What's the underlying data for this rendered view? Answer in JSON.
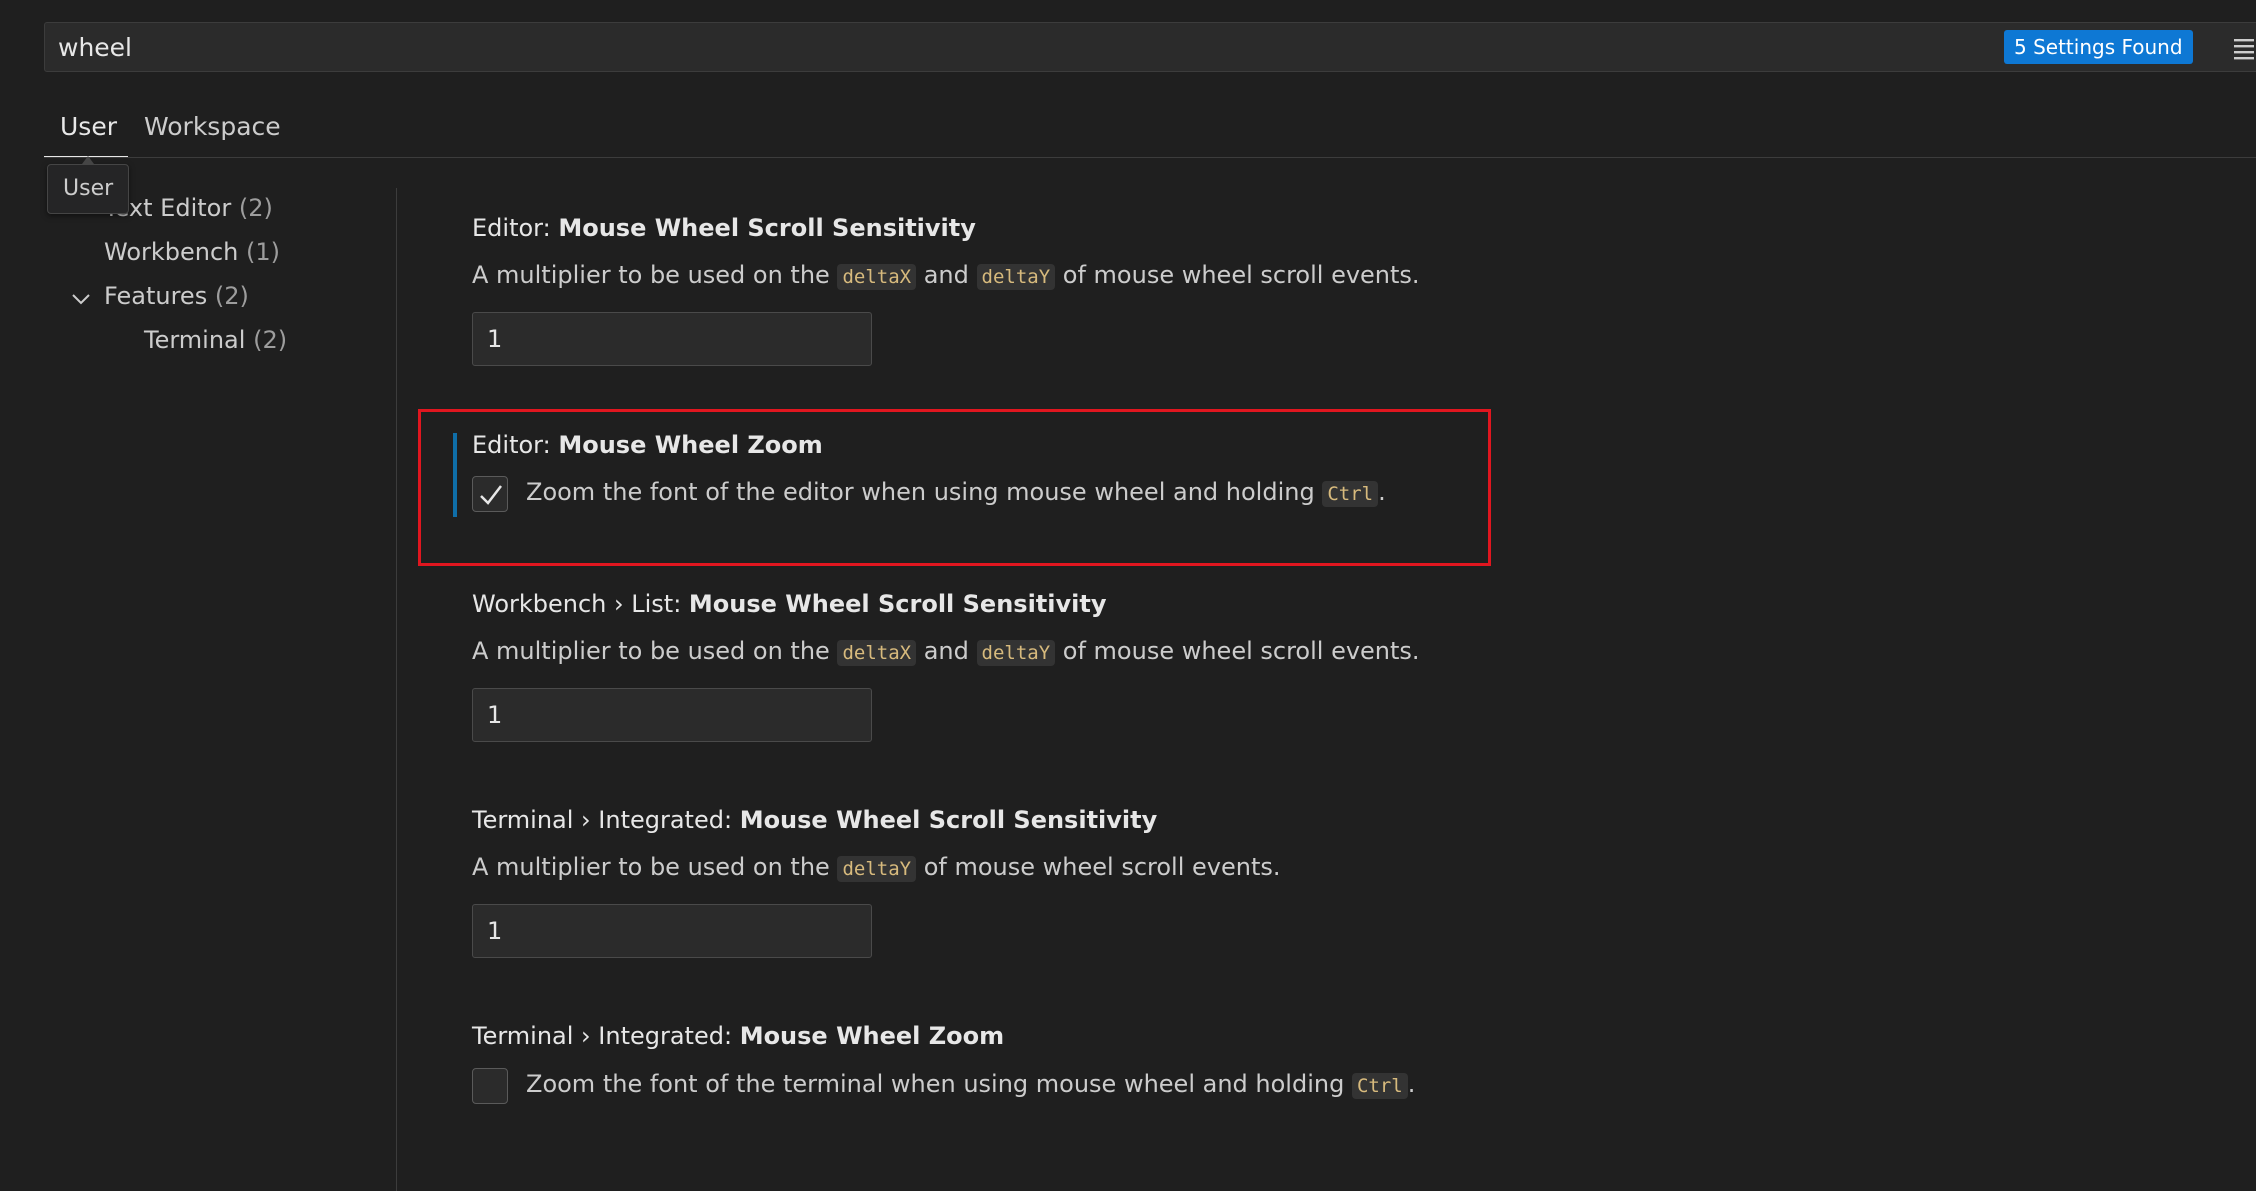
{
  "search": {
    "value": "wheel",
    "results_badge": "5 Settings Found",
    "filter_icon": "filter-list-icon"
  },
  "tabs": [
    {
      "label": "User",
      "active": true
    },
    {
      "label": "Workspace",
      "active": false
    }
  ],
  "tooltip": "User",
  "toc": {
    "items": [
      {
        "label": "Text Editor",
        "count": "(2)"
      },
      {
        "label": "Workbench",
        "count": "(1)"
      },
      {
        "label": "Features",
        "count": "(2)",
        "expanded": true
      },
      {
        "label": "Terminal",
        "count": "(2)"
      }
    ]
  },
  "settings": [
    {
      "category": "Editor: ",
      "name": "Mouse Wheel Scroll Sensitivity",
      "desc_parts": [
        "A multiplier to be used on the ",
        "deltaX",
        " and ",
        "deltaY",
        " of mouse wheel scroll events."
      ],
      "value": "1"
    },
    {
      "category": "Editor: ",
      "name": "Mouse Wheel Zoom",
      "desc_parts": [
        "Zoom the font of the editor when using mouse wheel and holding ",
        "Ctrl",
        "."
      ],
      "checked": true
    },
    {
      "category": "Workbench › List: ",
      "name": "Mouse Wheel Scroll Sensitivity",
      "desc_parts": [
        "A multiplier to be used on the ",
        "deltaX",
        " and ",
        "deltaY",
        " of mouse wheel scroll events."
      ],
      "value": "1"
    },
    {
      "category": "Terminal › Integrated: ",
      "name": "Mouse Wheel Scroll Sensitivity",
      "desc_parts": [
        "A multiplier to be used on the ",
        "deltaY",
        " of mouse wheel scroll events."
      ],
      "value": "1"
    },
    {
      "category": "Terminal › Integrated: ",
      "name": "Mouse Wheel Zoom",
      "desc_parts": [
        "Zoom the font of the terminal when using mouse wheel and holding ",
        "Ctrl",
        "."
      ],
      "checked": false
    }
  ],
  "colors": {
    "accent": "#0e78d4",
    "highlight_border": "#e0161f",
    "modified_indicator": "#0f6ea8"
  }
}
